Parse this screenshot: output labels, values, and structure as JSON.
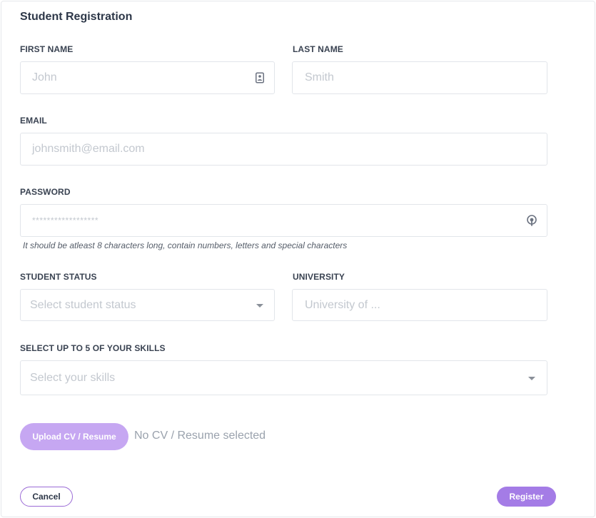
{
  "form": {
    "title": "Student Registration",
    "first_name": {
      "label": "FIRST NAME",
      "placeholder": "John",
      "value": ""
    },
    "last_name": {
      "label": "LAST NAME",
      "placeholder": "Smith",
      "value": ""
    },
    "email": {
      "label": "EMAIL",
      "placeholder": "johnsmith@email.com",
      "value": ""
    },
    "password": {
      "label": "PASSWORD",
      "placeholder": "******************",
      "hint": "It should be atleast 8 characters long, contain numbers, letters and special characters"
    },
    "student_status": {
      "label": "STUDENT STATUS",
      "placeholder": "Select student status"
    },
    "university": {
      "label": "UNIVERSITY",
      "placeholder": "University of ..."
    },
    "skills": {
      "label": "SELECT UP TO 5 OF YOUR SKILLS",
      "placeholder": "Select your skills"
    },
    "upload": {
      "button_label": "Upload CV / Resume",
      "status": "No CV / Resume selected"
    },
    "actions": {
      "cancel_label": "Cancel",
      "register_label": "Register"
    }
  },
  "icons": {
    "first_name_autofill": "contact-card-icon",
    "password_toggle": "password-visibility-icon",
    "student_status_dropdown": "caret-down-icon",
    "skills_dropdown": "caret-down-icon"
  },
  "colors": {
    "accent": "#a47ce6",
    "accent_light": "#c6a7f2",
    "text": "#2d3748",
    "placeholder": "#c3c8cf",
    "border": "#e2e5ea"
  }
}
